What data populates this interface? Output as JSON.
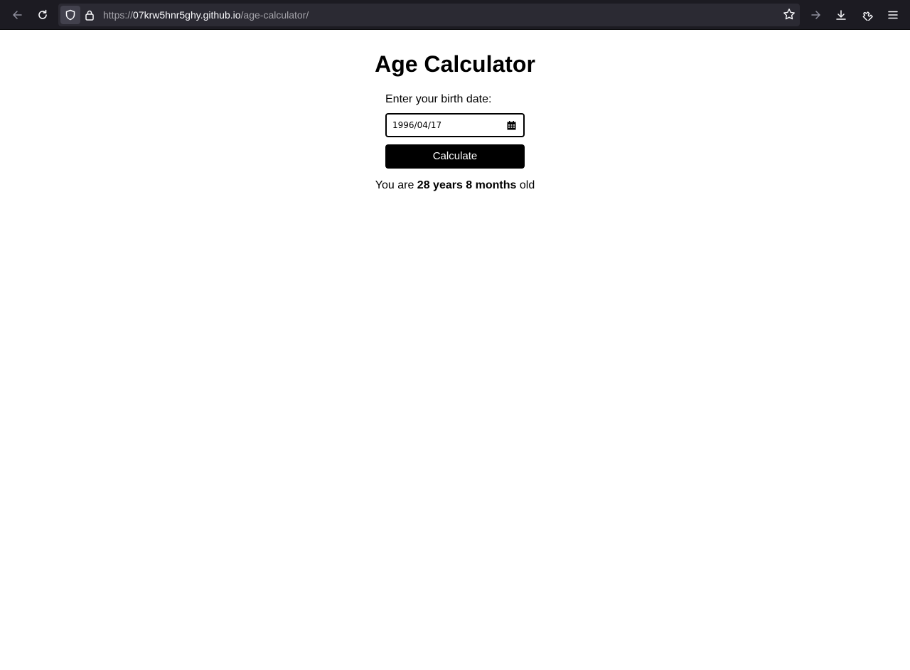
{
  "browser": {
    "url_prefix": "https://",
    "url_host": "07krw5hnr5ghy.github.io",
    "url_path": "/age-calculator/",
    "icons": [
      "back-arrow-icon",
      "reload-icon",
      "shield-icon",
      "lock-icon",
      "star-icon",
      "forward-arrow-icon",
      "download-icon",
      "extensions-icon",
      "menu-icon"
    ]
  },
  "page": {
    "title": "Age Calculator",
    "birth_label": "Enter your birth date:",
    "birth_date_value": "1996/04/17",
    "calculate_label": "Calculate",
    "result": {
      "prefix": "You are",
      "age": "28 years 8 months",
      "suffix": "old"
    }
  },
  "colors": {
    "toolbar_bg": "#1c1b22",
    "urlbar_bg": "#2b2a33",
    "button_bg": "#000000",
    "button_text": "#ffffff"
  }
}
